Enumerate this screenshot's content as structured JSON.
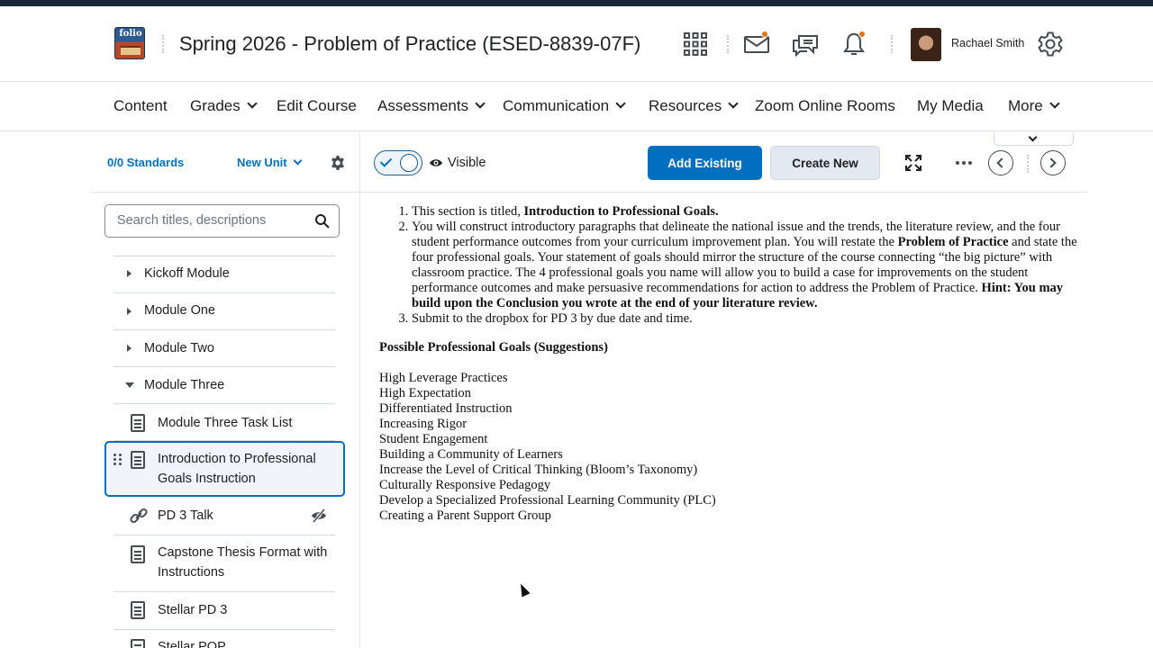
{
  "header": {
    "logo_text": "folio",
    "course_title": "Spring 2026 - Problem of Practice (ESED-8839-07F)",
    "username": "Rachael Smith",
    "icons": [
      "grid-icon",
      "mail-icon",
      "chat-icon",
      "bell-icon",
      "gear-icon"
    ],
    "notification_color": "#e87511"
  },
  "nav": {
    "items": [
      {
        "label": "Content"
      },
      {
        "label": "Grades"
      },
      {
        "label": "Edit Course"
      },
      {
        "label": "Assessments"
      },
      {
        "label": "Communication"
      },
      {
        "label": "Resources"
      },
      {
        "label": "Zoom Online Rooms"
      },
      {
        "label": "My Media"
      },
      {
        "label": "More"
      }
    ]
  },
  "left": {
    "standards": "0/0 Standards",
    "new_unit": "New Unit",
    "search_placeholder": "Search titles, descriptions",
    "tree": [
      {
        "label": "Kickoff Module"
      },
      {
        "label": "Module One"
      },
      {
        "label": "Module Two"
      },
      {
        "label": "Module Three"
      },
      {
        "label": "Module Three Task List"
      },
      {
        "label": "Introduction to Professional Goals Instruction"
      },
      {
        "label": "PD 3 Talk"
      },
      {
        "label": "Capstone Thesis Format with Instructions"
      },
      {
        "label": "Stellar PD 3"
      },
      {
        "label": "Stellar POP"
      }
    ]
  },
  "toolbar": {
    "visible_label": "Visible",
    "add_existing": "Add Existing",
    "create_new": "Create New",
    "accent": "#006fbf"
  },
  "content": {
    "item1_pre": "This section is titled, ",
    "item1_bold": "Introduction to Professional Goals.",
    "item2_a": "You will construct introductory paragraphs that delineate the national issue and the trends, the literature review, and the four student performance outcomes from your curriculum improvement plan. You will restate the ",
    "item2_bold1": "Problem of Practice",
    "item2_b": " and state the four professional goals. Your statement of goals should mirror the structure of the course connecting “the big picture” with classroom practice. The 4 professional goals you name will allow you to build a case for improvements on the student performance outcomes and make persuasive recommendations for action to address the Problem of Practice. ",
    "item2_bold2": "Hint: You may build upon the Conclusion you wrote at the end of your literature review.",
    "item3": "Submit to the dropbox for PD 3 by due date and time.",
    "goals_heading": "Possible Professional Goals (Suggestions)",
    "goals": [
      "High Leverage Practices",
      "High Expectation",
      "Differentiated Instruction",
      "Increasing Rigor",
      "Student Engagement",
      "Building a Community of Learners",
      "Increase the Level of Critical Thinking (Bloom’s Taxonomy)",
      "Culturally Responsive Pedagogy",
      "Develop a Specialized Professional Learning Community (PLC)",
      "Creating a Parent Support Group"
    ]
  }
}
